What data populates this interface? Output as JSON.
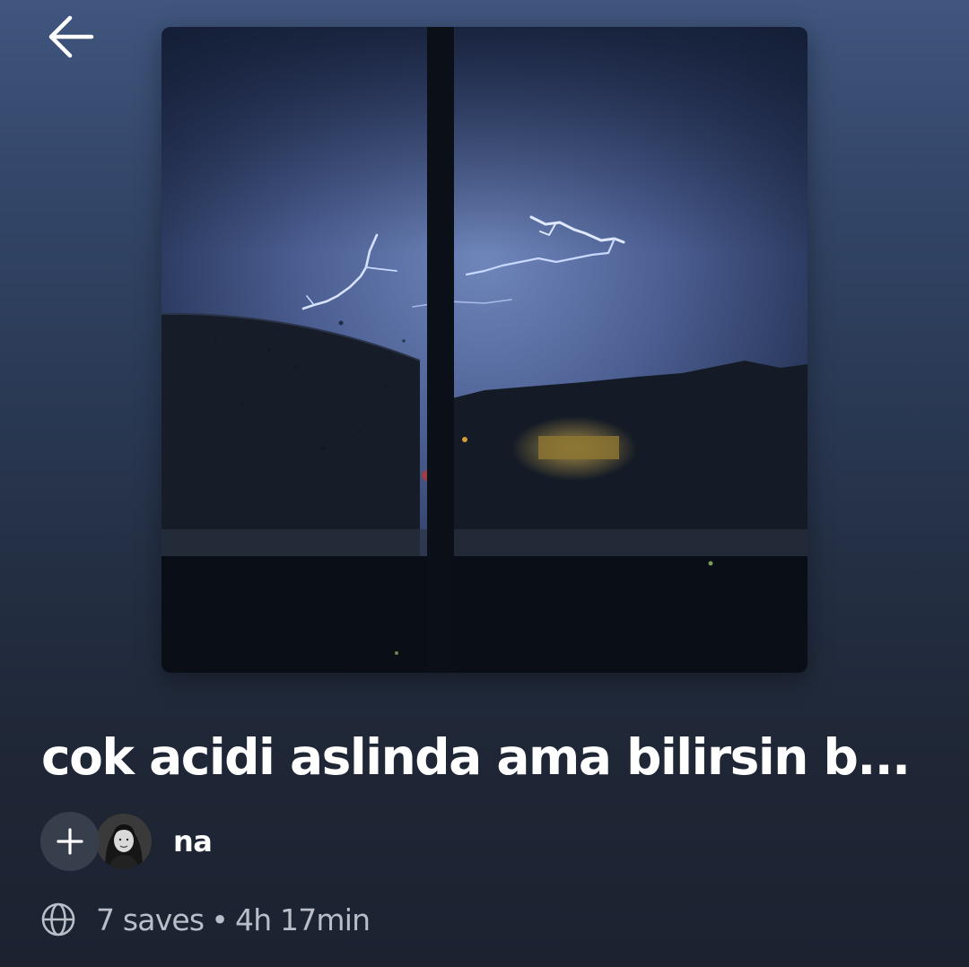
{
  "header": {
    "back_icon": "arrow-left-icon"
  },
  "playlist": {
    "cover_image": "night-storm-lightning-through-window",
    "title": "cok acidi aslinda ama bilirsin b...",
    "add_icon": "plus-icon",
    "owner_name": "na",
    "visibility_icon": "globe-icon",
    "saves": "7 saves",
    "separator": "•",
    "duration": "4h 17min"
  },
  "colors": {
    "background_top": "#40567e",
    "background_bottom": "#1b2230",
    "text_primary": "#ffffff",
    "text_secondary": "#b9bec8",
    "add_button_bg": "#383f4c"
  }
}
